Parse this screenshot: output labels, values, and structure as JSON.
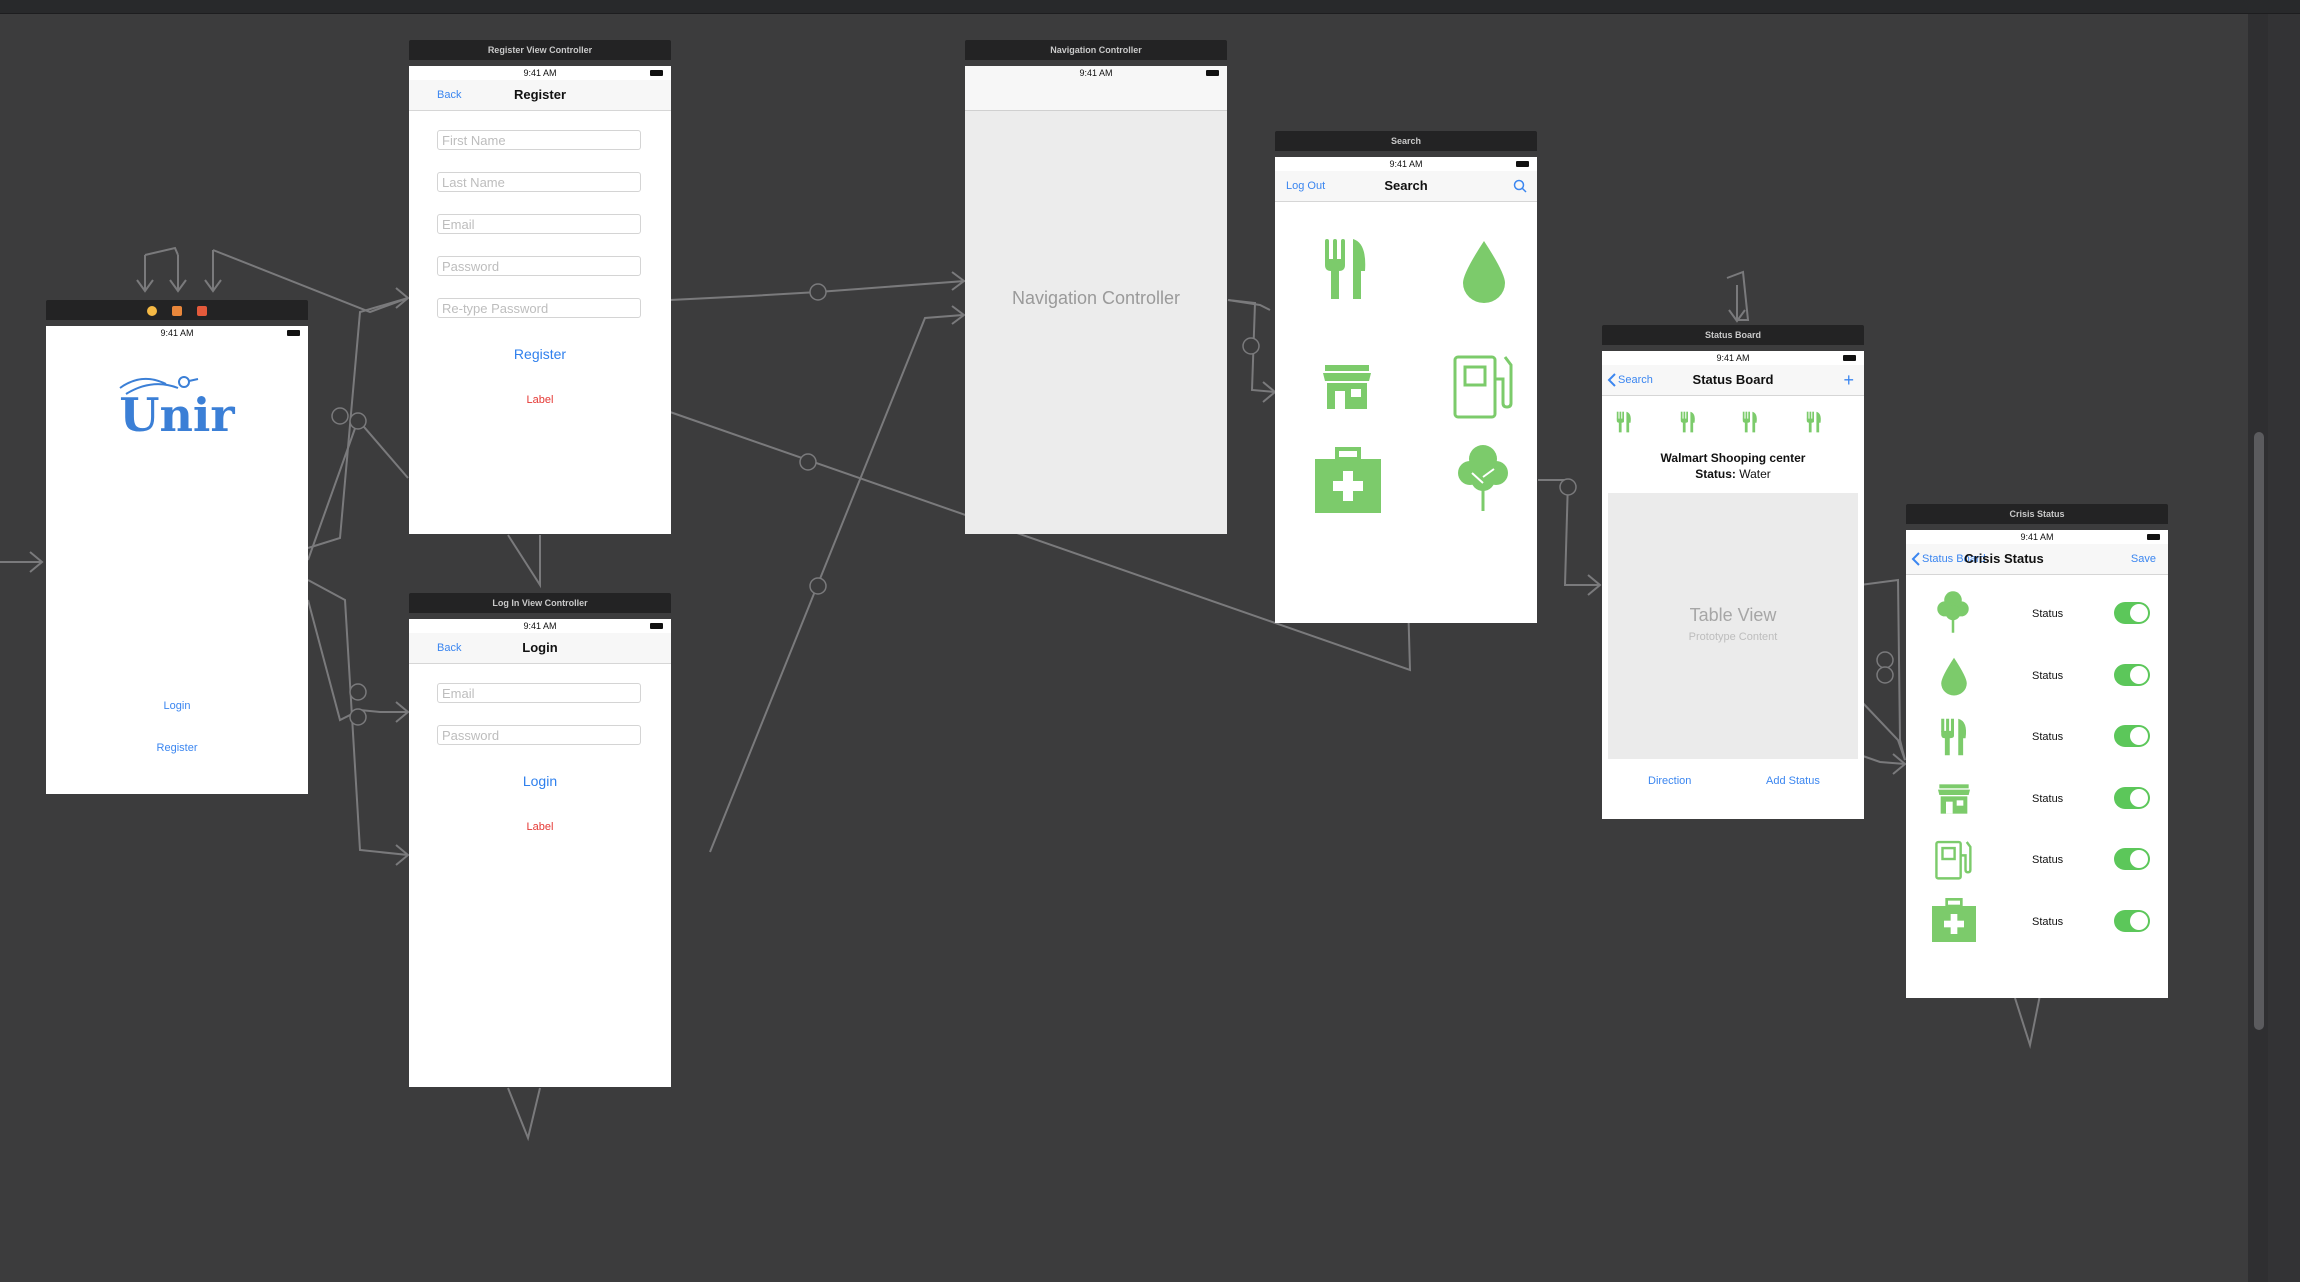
{
  "scenes": {
    "root": {
      "time": "9:41 AM",
      "logo": "Unir",
      "login_link": "Login",
      "register_link": "Register"
    },
    "register": {
      "title": "Register View Controller",
      "time": "9:41 AM",
      "back": "Back",
      "nav_title": "Register",
      "placeholders": [
        "First Name",
        "Last Name",
        "Email",
        "Password",
        "Re-type Password"
      ],
      "button": "Register",
      "label": "Label"
    },
    "login": {
      "title": "Log In View Controller",
      "time": "9:41 AM",
      "back": "Back",
      "nav_title": "Login",
      "placeholders": [
        "Email",
        "Password"
      ],
      "button": "Login",
      "label": "Label"
    },
    "navigation": {
      "title": "Navigation Controller",
      "time": "9:41 AM",
      "body_text": "Navigation Controller"
    },
    "search": {
      "title": "Search",
      "time": "9:41 AM",
      "left": "Log Out",
      "nav_title": "Search",
      "icons": [
        "fork-knife-icon",
        "water-drop-icon",
        "store-icon",
        "gas-pump-icon",
        "first-aid-icon",
        "tree-icon"
      ]
    },
    "status_board": {
      "title": "Status Board",
      "time": "9:41 AM",
      "back": "Search",
      "nav_title": "Status Board",
      "add": "+",
      "place": "Walmart Shooping center",
      "status_label": "Status:",
      "status_value": "Water",
      "table_title": "Table View",
      "table_subtitle": "Prototype Content",
      "direction": "Direction",
      "add_status": "Add Status"
    },
    "crisis": {
      "title": "Crisis Status",
      "time": "9:41 AM",
      "back": "Status Board",
      "nav_title": "Crisis Status",
      "save": "Save",
      "rows": [
        {
          "icon": "tree-icon",
          "label": "Status",
          "on": true
        },
        {
          "icon": "water-drop-icon",
          "label": "Status",
          "on": true
        },
        {
          "icon": "fork-knife-icon",
          "label": "Status",
          "on": true
        },
        {
          "icon": "store-icon",
          "label": "Status",
          "on": true
        },
        {
          "icon": "gas-pump-icon",
          "label": "Status",
          "on": true
        },
        {
          "icon": "first-aid-icon",
          "label": "Status",
          "on": true
        }
      ]
    }
  },
  "colors": {
    "canvas": "#3c3c3d",
    "accent_blue": "#3b86f0",
    "icon_green": "#7ccb6b",
    "toggle_green": "#5cc75a",
    "error_red": "#e53935"
  }
}
